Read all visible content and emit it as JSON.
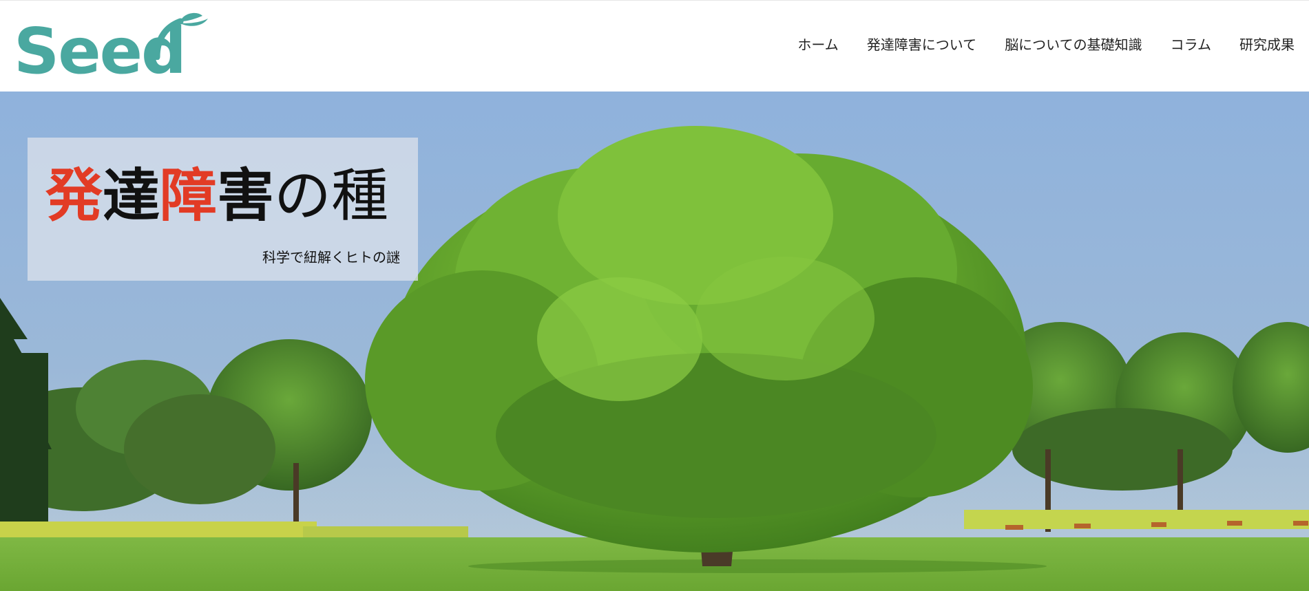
{
  "header": {
    "logo": {
      "text": "Seed",
      "color": "#4aa8a0"
    },
    "nav": [
      {
        "label": "ホーム"
      },
      {
        "label": "発達障害について"
      },
      {
        "label": "脳についての基礎知識"
      },
      {
        "label": "コラム"
      },
      {
        "label": "研究成果"
      }
    ]
  },
  "hero": {
    "title_parts": [
      "発",
      "達",
      "障",
      "害",
      "の",
      "種"
    ],
    "title_accent_color": "#e23b25",
    "subtitle": "科学で紐解くヒトの謎",
    "image": "large-green-tree-in-park"
  }
}
